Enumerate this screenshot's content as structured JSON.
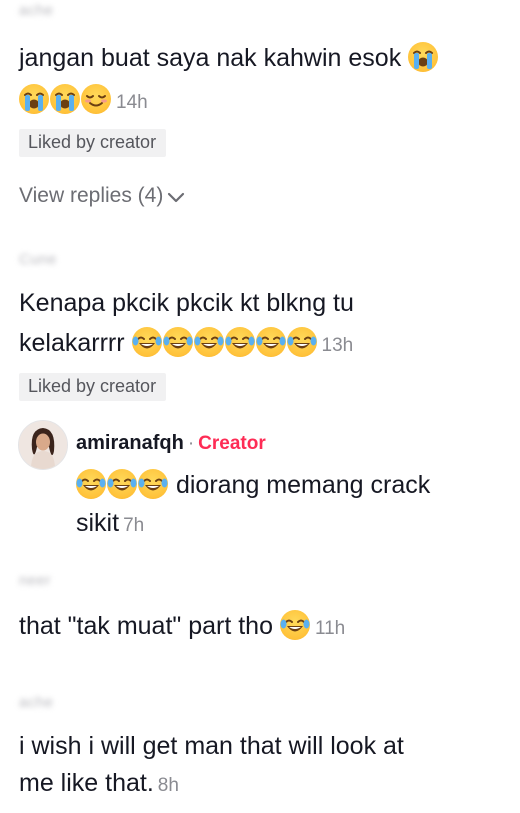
{
  "comments": [
    {
      "username": "ache",
      "text": "jangan buat saya nak kahwin esok",
      "emoji_line1": [
        "loudly-crying-emoji"
      ],
      "emoji_line2": [
        "loudly-crying-emoji",
        "loudly-crying-emoji",
        "relieved-face-emoji"
      ],
      "time": "14h",
      "liked_badge": "Liked by creator",
      "view_replies": "View replies (4)"
    },
    {
      "username": "Cune",
      "text_line1": "Kenapa pkcik pkcik kt blkng tu",
      "text_line2": "kelakarrrr",
      "emojis": [
        "joy-emoji",
        "joy-emoji",
        "joy-emoji",
        "joy-emoji",
        "joy-emoji",
        "joy-emoji"
      ],
      "time": "13h",
      "liked_badge": "Liked by creator",
      "reply": {
        "username": "amiranafqh",
        "separator": "·",
        "badge": "Creator",
        "emojis": [
          "joy-emoji",
          "joy-emoji",
          "joy-emoji"
        ],
        "text_line1": "diorang memang crack",
        "text_line2": "sikit",
        "time": "7h"
      }
    },
    {
      "username": "neer",
      "text": "that \"tak muat\" part tho",
      "emojis": [
        "joy-emoji"
      ],
      "time": "11h"
    },
    {
      "username": "ache",
      "text_line1": "i wish i will get man that will look at",
      "text_line2": "me like that.",
      "time": "8h"
    }
  ],
  "colors": {
    "text": "#161823",
    "muted": "#8a8b91",
    "creator_accent": "#fe2c55",
    "badge_bg": "#f1f1f2",
    "emoji_yellow": "#ffc23a"
  }
}
